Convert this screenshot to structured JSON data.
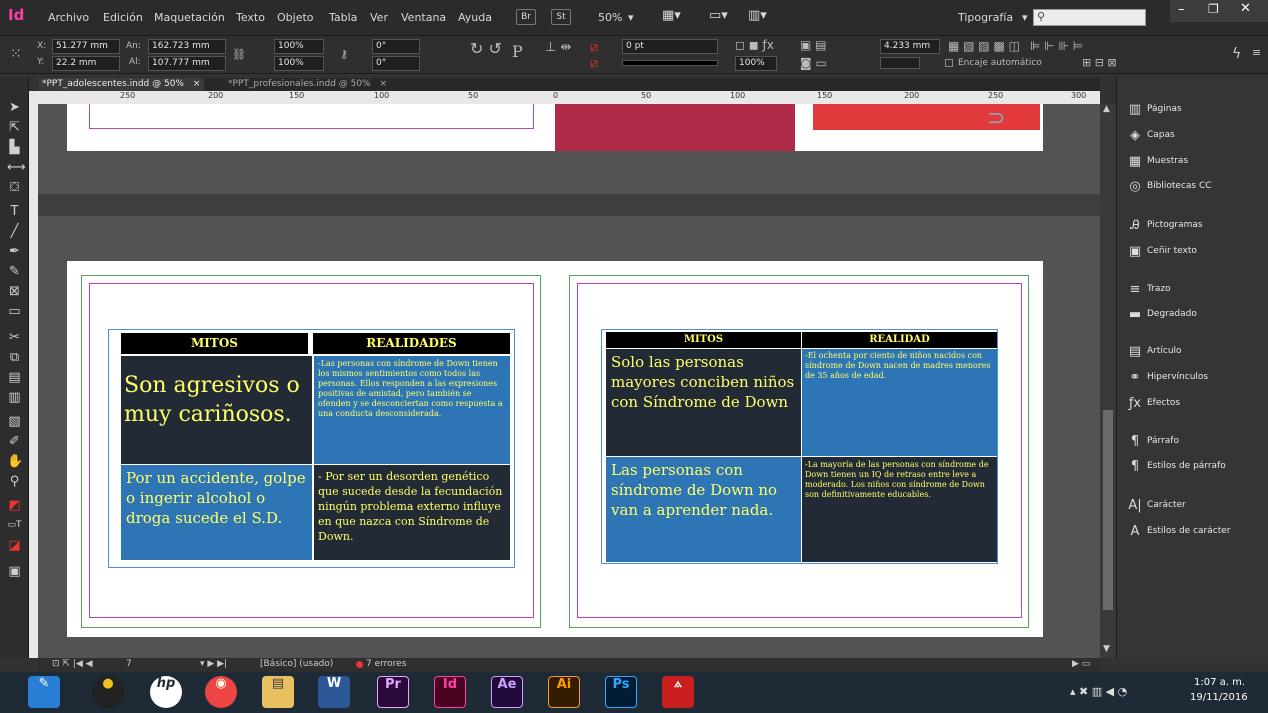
{
  "app": {
    "logo": "Id",
    "workspace": "Tipografía"
  },
  "menu": [
    "Archivo",
    "Edición",
    "Maquetación",
    "Texto",
    "Objeto",
    "Tabla",
    "Ver",
    "Ventana",
    "Ayuda"
  ],
  "toolbar": {
    "br": "Br",
    "st": "St",
    "zoom": "50%"
  },
  "control": {
    "x": "51.277 mm",
    "y": "22.2 mm",
    "w": "162.723 mm",
    "h": "107.777 mm",
    "w_label": "An:",
    "h_label": "Al:",
    "scale_x": "100%",
    "scale_y": "100%",
    "angle": "0°",
    "shear": "0°",
    "stroke": "0 pt",
    "opacity": "100%",
    "col_w": "4.233 mm",
    "autofit": "Encaje automático"
  },
  "tabs": [
    {
      "label": "*PPT_adolescentes.indd @ 50%",
      "close": "×",
      "active": true
    },
    {
      "label": "*PPT_profesionales.indd @ 50%",
      "close": "×",
      "active": false
    }
  ],
  "ruler": {
    "ticks": [
      "250",
      "200",
      "150",
      "100",
      "50",
      "0",
      "50",
      "100",
      "150",
      "200",
      "250",
      "300"
    ]
  },
  "panel": {
    "items": [
      {
        "icon": "pages-icon",
        "glyph": "▥",
        "label": "Páginas"
      },
      {
        "icon": "layers-icon",
        "glyph": "◈",
        "label": "Capas"
      },
      {
        "icon": "swatches-icon",
        "glyph": "▦",
        "label": "Muestras"
      },
      {
        "icon": "cc-libraries-icon",
        "glyph": "◎",
        "label": "Bibliotecas CC"
      },
      {
        "icon": "glyphs-icon",
        "glyph": "Ꭿ",
        "label": "Pictogramas"
      },
      {
        "icon": "text-wrap-icon",
        "glyph": "▣",
        "label": "Ceñir texto"
      },
      {
        "icon": "stroke-icon",
        "glyph": "≡",
        "label": "Trazo"
      },
      {
        "icon": "gradient-icon",
        "glyph": "▬",
        "label": "Degradado"
      },
      {
        "icon": "article-icon",
        "glyph": "▤",
        "label": "Artículo"
      },
      {
        "icon": "hyperlinks-icon",
        "glyph": "⚭",
        "label": "Hipervínculos"
      },
      {
        "icon": "effects-icon",
        "glyph": "ƒx",
        "label": "Efectos"
      },
      {
        "icon": "paragraph-icon",
        "glyph": "¶",
        "label": "Párrafo"
      },
      {
        "icon": "paragraph-styles-icon",
        "glyph": "¶",
        "label": "Estilos de párrafo"
      },
      {
        "icon": "character-icon",
        "glyph": "A|",
        "label": "Carácter"
      },
      {
        "icon": "character-styles-icon",
        "glyph": "A",
        "label": "Estilos de carácter"
      }
    ]
  },
  "status": {
    "page": "7",
    "master": "[Básico] (usado)",
    "errors": "7 errores"
  },
  "taskbar": {
    "time": "1:07 a. m.",
    "date": "19/11/2016",
    "apps": [
      "Pr",
      "Id",
      "Ae",
      "Ai",
      "Ps"
    ]
  },
  "left_table": {
    "h1": "MITOS",
    "h2": "REALIDADES",
    "r1c1": "Son agresivos o muy cariñosos.",
    "r1c2": "-Las personas con síndrome de Down tienen los mismos sentimientos como todos las personas. Ellos responden a las expresiones positivas de amistad, pero también se ofenden y se desconciertan como respuesta a una conducta desconsiderada.",
    "r2c1": "Por un accidente, golpe o ingerir alcohol o droga sucede el S.D.",
    "r2c2": "- Por ser un desorden genético que sucede desde la fecundación ningún problema externo influye en que nazca con Síndrome de Down."
  },
  "right_table": {
    "h1": "MITOS",
    "h2": "REALIDAD",
    "r1c1": "Solo las personas mayores conciben niños con Síndrome de Down",
    "r1c2": "-El ochenta por ciento de niños nacidos con síndrome de Down nacen de madres menores de 35 años de edad.",
    "r2c1": "Las personas con síndrome de Down no van a aprender nada.",
    "r2c2": "-La mayoría de las personas con síndrome de Down tienen un IQ de retraso entre leve a moderado. Los niños con síndrome de Down son definitivamente educables."
  },
  "colors": {
    "cell_blue": "#2e75b6",
    "cell_dark": "#222a35",
    "text_yellow": "#ffff66"
  }
}
